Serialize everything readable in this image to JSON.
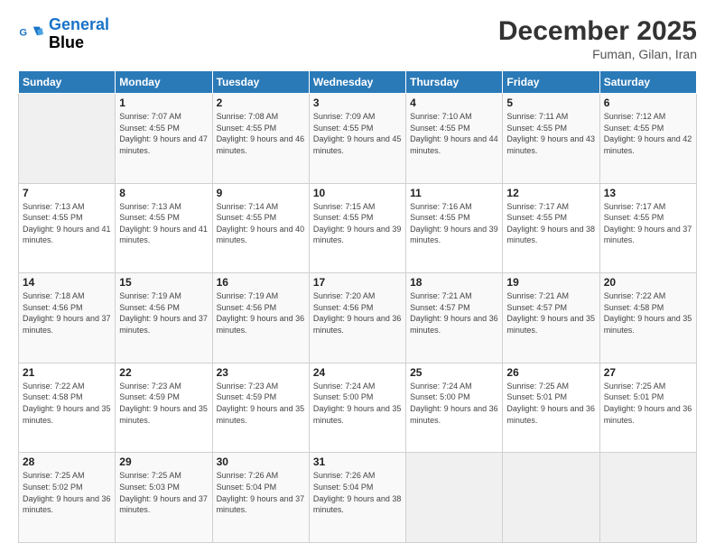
{
  "logo": {
    "line1": "General",
    "line2": "Blue"
  },
  "header": {
    "title": "December 2025",
    "subtitle": "Fuman, Gilan, Iran"
  },
  "weekdays": [
    "Sunday",
    "Monday",
    "Tuesday",
    "Wednesday",
    "Thursday",
    "Friday",
    "Saturday"
  ],
  "weeks": [
    [
      {
        "day": "",
        "sunrise": "",
        "sunset": "",
        "daylight": ""
      },
      {
        "day": "1",
        "sunrise": "Sunrise: 7:07 AM",
        "sunset": "Sunset: 4:55 PM",
        "daylight": "Daylight: 9 hours and 47 minutes."
      },
      {
        "day": "2",
        "sunrise": "Sunrise: 7:08 AM",
        "sunset": "Sunset: 4:55 PM",
        "daylight": "Daylight: 9 hours and 46 minutes."
      },
      {
        "day": "3",
        "sunrise": "Sunrise: 7:09 AM",
        "sunset": "Sunset: 4:55 PM",
        "daylight": "Daylight: 9 hours and 45 minutes."
      },
      {
        "day": "4",
        "sunrise": "Sunrise: 7:10 AM",
        "sunset": "Sunset: 4:55 PM",
        "daylight": "Daylight: 9 hours and 44 minutes."
      },
      {
        "day": "5",
        "sunrise": "Sunrise: 7:11 AM",
        "sunset": "Sunset: 4:55 PM",
        "daylight": "Daylight: 9 hours and 43 minutes."
      },
      {
        "day": "6",
        "sunrise": "Sunrise: 7:12 AM",
        "sunset": "Sunset: 4:55 PM",
        "daylight": "Daylight: 9 hours and 42 minutes."
      }
    ],
    [
      {
        "day": "7",
        "sunrise": "Sunrise: 7:13 AM",
        "sunset": "Sunset: 4:55 PM",
        "daylight": "Daylight: 9 hours and 41 minutes."
      },
      {
        "day": "8",
        "sunrise": "Sunrise: 7:13 AM",
        "sunset": "Sunset: 4:55 PM",
        "daylight": "Daylight: 9 hours and 41 minutes."
      },
      {
        "day": "9",
        "sunrise": "Sunrise: 7:14 AM",
        "sunset": "Sunset: 4:55 PM",
        "daylight": "Daylight: 9 hours and 40 minutes."
      },
      {
        "day": "10",
        "sunrise": "Sunrise: 7:15 AM",
        "sunset": "Sunset: 4:55 PM",
        "daylight": "Daylight: 9 hours and 39 minutes."
      },
      {
        "day": "11",
        "sunrise": "Sunrise: 7:16 AM",
        "sunset": "Sunset: 4:55 PM",
        "daylight": "Daylight: 9 hours and 39 minutes."
      },
      {
        "day": "12",
        "sunrise": "Sunrise: 7:17 AM",
        "sunset": "Sunset: 4:55 PM",
        "daylight": "Daylight: 9 hours and 38 minutes."
      },
      {
        "day": "13",
        "sunrise": "Sunrise: 7:17 AM",
        "sunset": "Sunset: 4:55 PM",
        "daylight": "Daylight: 9 hours and 37 minutes."
      }
    ],
    [
      {
        "day": "14",
        "sunrise": "Sunrise: 7:18 AM",
        "sunset": "Sunset: 4:56 PM",
        "daylight": "Daylight: 9 hours and 37 minutes."
      },
      {
        "day": "15",
        "sunrise": "Sunrise: 7:19 AM",
        "sunset": "Sunset: 4:56 PM",
        "daylight": "Daylight: 9 hours and 37 minutes."
      },
      {
        "day": "16",
        "sunrise": "Sunrise: 7:19 AM",
        "sunset": "Sunset: 4:56 PM",
        "daylight": "Daylight: 9 hours and 36 minutes."
      },
      {
        "day": "17",
        "sunrise": "Sunrise: 7:20 AM",
        "sunset": "Sunset: 4:56 PM",
        "daylight": "Daylight: 9 hours and 36 minutes."
      },
      {
        "day": "18",
        "sunrise": "Sunrise: 7:21 AM",
        "sunset": "Sunset: 4:57 PM",
        "daylight": "Daylight: 9 hours and 36 minutes."
      },
      {
        "day": "19",
        "sunrise": "Sunrise: 7:21 AM",
        "sunset": "Sunset: 4:57 PM",
        "daylight": "Daylight: 9 hours and 35 minutes."
      },
      {
        "day": "20",
        "sunrise": "Sunrise: 7:22 AM",
        "sunset": "Sunset: 4:58 PM",
        "daylight": "Daylight: 9 hours and 35 minutes."
      }
    ],
    [
      {
        "day": "21",
        "sunrise": "Sunrise: 7:22 AM",
        "sunset": "Sunset: 4:58 PM",
        "daylight": "Daylight: 9 hours and 35 minutes."
      },
      {
        "day": "22",
        "sunrise": "Sunrise: 7:23 AM",
        "sunset": "Sunset: 4:59 PM",
        "daylight": "Daylight: 9 hours and 35 minutes."
      },
      {
        "day": "23",
        "sunrise": "Sunrise: 7:23 AM",
        "sunset": "Sunset: 4:59 PM",
        "daylight": "Daylight: 9 hours and 35 minutes."
      },
      {
        "day": "24",
        "sunrise": "Sunrise: 7:24 AM",
        "sunset": "Sunset: 5:00 PM",
        "daylight": "Daylight: 9 hours and 35 minutes."
      },
      {
        "day": "25",
        "sunrise": "Sunrise: 7:24 AM",
        "sunset": "Sunset: 5:00 PM",
        "daylight": "Daylight: 9 hours and 36 minutes."
      },
      {
        "day": "26",
        "sunrise": "Sunrise: 7:25 AM",
        "sunset": "Sunset: 5:01 PM",
        "daylight": "Daylight: 9 hours and 36 minutes."
      },
      {
        "day": "27",
        "sunrise": "Sunrise: 7:25 AM",
        "sunset": "Sunset: 5:01 PM",
        "daylight": "Daylight: 9 hours and 36 minutes."
      }
    ],
    [
      {
        "day": "28",
        "sunrise": "Sunrise: 7:25 AM",
        "sunset": "Sunset: 5:02 PM",
        "daylight": "Daylight: 9 hours and 36 minutes."
      },
      {
        "day": "29",
        "sunrise": "Sunrise: 7:25 AM",
        "sunset": "Sunset: 5:03 PM",
        "daylight": "Daylight: 9 hours and 37 minutes."
      },
      {
        "day": "30",
        "sunrise": "Sunrise: 7:26 AM",
        "sunset": "Sunset: 5:04 PM",
        "daylight": "Daylight: 9 hours and 37 minutes."
      },
      {
        "day": "31",
        "sunrise": "Sunrise: 7:26 AM",
        "sunset": "Sunset: 5:04 PM",
        "daylight": "Daylight: 9 hours and 38 minutes."
      },
      {
        "day": "",
        "sunrise": "",
        "sunset": "",
        "daylight": ""
      },
      {
        "day": "",
        "sunrise": "",
        "sunset": "",
        "daylight": ""
      },
      {
        "day": "",
        "sunrise": "",
        "sunset": "",
        "daylight": ""
      }
    ]
  ]
}
